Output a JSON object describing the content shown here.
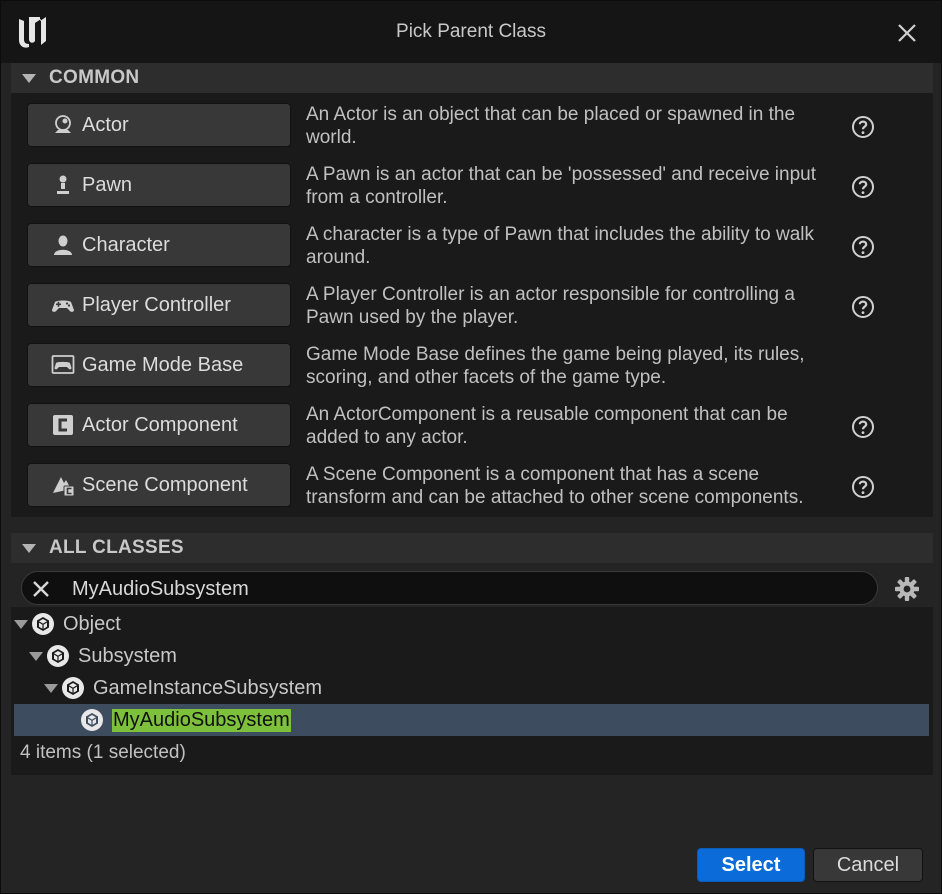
{
  "window": {
    "title": "Pick Parent Class"
  },
  "common": {
    "header": "COMMON",
    "items": [
      {
        "label": "Actor",
        "icon": "actor-icon",
        "description": "An Actor is an object that can be placed or spawned in the world.",
        "help": true
      },
      {
        "label": "Pawn",
        "icon": "pawn-icon",
        "description": "A Pawn is an actor that can be 'possessed' and receive input from a controller.",
        "help": true
      },
      {
        "label": "Character",
        "icon": "character-icon",
        "description": "A character is a type of Pawn that includes the ability to walk around.",
        "help": true
      },
      {
        "label": "Player Controller",
        "icon": "gamepad-icon",
        "description": "A Player Controller is an actor responsible for controlling a Pawn used by the player.",
        "help": true
      },
      {
        "label": "Game Mode Base",
        "icon": "game-mode-icon",
        "description": "Game Mode Base defines the game being played, its rules, scoring, and other facets of the game type.",
        "help": false
      },
      {
        "label": "Actor Component",
        "icon": "actor-component-icon",
        "description": "An ActorComponent is a reusable component that can be added to any actor.",
        "help": true
      },
      {
        "label": "Scene Component",
        "icon": "scene-component-icon",
        "description": "A Scene Component is a component that has a scene transform and can be attached to other scene components.",
        "help": true
      }
    ]
  },
  "all_classes": {
    "header": "ALL CLASSES",
    "search": {
      "value": "MyAudioSubsystem",
      "placeholder": ""
    },
    "tree": [
      {
        "name": "Object",
        "depth": 0,
        "expanded": true,
        "selected": false
      },
      {
        "name": "Subsystem",
        "depth": 1,
        "expanded": true,
        "selected": false
      },
      {
        "name": "GameInstanceSubsystem",
        "depth": 2,
        "expanded": true,
        "selected": false
      },
      {
        "name": "MyAudioSubsystem",
        "depth": 3,
        "expanded": false,
        "selected": true
      }
    ],
    "status": "4 items (1 selected)"
  },
  "footer": {
    "select_label": "Select",
    "cancel_label": "Cancel"
  },
  "colors": {
    "accent": "#0a6bd9",
    "highlight": "#7cc03c",
    "selection": "#3d4d5f"
  }
}
